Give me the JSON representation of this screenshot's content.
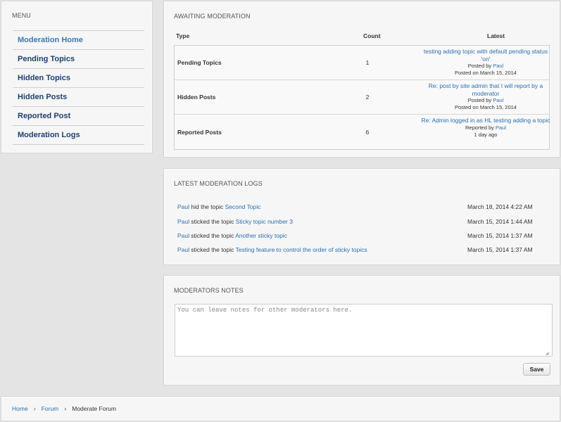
{
  "menu": {
    "title": "MENU",
    "items": [
      {
        "label": "Moderation Home"
      },
      {
        "label": "Pending Topics"
      },
      {
        "label": "Hidden Topics"
      },
      {
        "label": "Hidden Posts"
      },
      {
        "label": "Reported Post"
      },
      {
        "label": "Moderation Logs"
      }
    ]
  },
  "awaiting": {
    "title": "AWAITING MODERATION",
    "columns": {
      "type": "Type",
      "count": "Count",
      "latest": "Latest"
    },
    "rows": [
      {
        "type": "Pending Topics",
        "count": "1",
        "latest_title": "testing adding topic with default pending status 'on'",
        "posted_by_prefix": "Posted by",
        "user": "Paul",
        "date": "Posted on March 15, 2014"
      },
      {
        "type": "Hidden Posts",
        "count": "2",
        "latest_title": "Re: post by site admin that I will report by a moderator",
        "posted_by_prefix": "Posted by",
        "user": "Paul",
        "date": "Posted on March 15, 2014"
      },
      {
        "type": "Reported Posts",
        "count": "6",
        "latest_title": "Re: Admin logged in as HL testing adding a topic",
        "posted_by_prefix": "Reported by",
        "user": "Paul",
        "date": "1 day ago"
      }
    ]
  },
  "logs": {
    "title": "LATEST MODERATION LOGS",
    "rows": [
      {
        "user": "Paul",
        "action": "hid the topic",
        "topic": "Second Topic",
        "date": "March 18, 2014 4:22 AM"
      },
      {
        "user": "Paul",
        "action": "sticked the topic",
        "topic": "Sticky topic number 3",
        "date": "March 15, 2014 1:44 AM"
      },
      {
        "user": "Paul",
        "action": "sticked the topic",
        "topic": "Another sticky topic",
        "date": "March 15, 2014 1:37 AM"
      },
      {
        "user": "Paul",
        "action": "sticked the topic",
        "topic": "Testing feature to control the order of sticky topics",
        "date": "March 15, 2014 1:37 AM"
      }
    ]
  },
  "notes": {
    "title": "MODERATORS NOTES",
    "placeholder": "You can leave notes for other moderators here.",
    "value": "",
    "save_label": "Save"
  },
  "breadcrumb": {
    "items": [
      "Home",
      "Forum",
      "Moderate Forum"
    ],
    "separator": "›"
  },
  "colors": {
    "link": "#2a6fb0",
    "menu_link": "#1c3f6e",
    "background": "#e4e4e4",
    "panel": "#f6f6f6"
  }
}
